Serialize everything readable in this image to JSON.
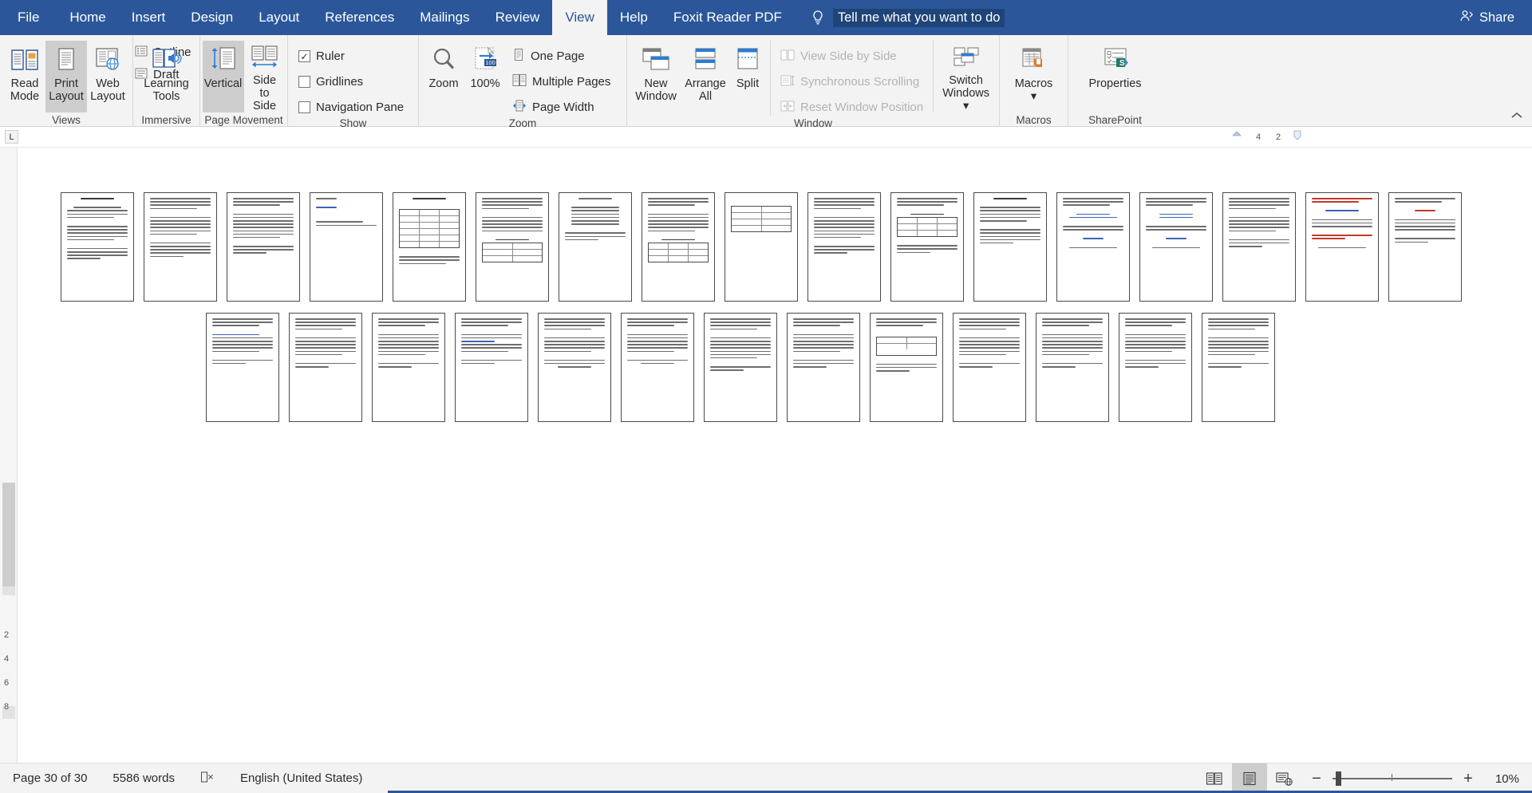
{
  "app": {
    "ribbon_tabs": [
      {
        "label": "File",
        "active": false
      },
      {
        "label": "Home",
        "active": false
      },
      {
        "label": "Insert",
        "active": false
      },
      {
        "label": "Design",
        "active": false
      },
      {
        "label": "Layout",
        "active": false
      },
      {
        "label": "References",
        "active": false
      },
      {
        "label": "Mailings",
        "active": false
      },
      {
        "label": "Review",
        "active": false
      },
      {
        "label": "View",
        "active": true
      },
      {
        "label": "Help",
        "active": false
      },
      {
        "label": "Foxit Reader PDF",
        "active": false
      }
    ],
    "tellme": {
      "icon": "lightbulb-icon",
      "text": "Tell me what you want to do"
    },
    "share": {
      "icon": "share-person-icon",
      "label": "Share"
    },
    "accent_color": "#2b579a",
    "tab_active_bg": "#f3f3f3"
  },
  "ribbon": {
    "groups": [
      {
        "name": "views",
        "label": "Views",
        "buttons": [
          {
            "name": "read-mode",
            "label_line1": "Read",
            "label_line2": "Mode",
            "icon": "read-mode-icon",
            "selected": false
          },
          {
            "name": "print-layout",
            "label_line1": "Print",
            "label_line2": "Layout",
            "icon": "print-layout-icon",
            "selected": true
          },
          {
            "name": "web-layout",
            "label_line1": "Web",
            "label_line2": "Layout",
            "icon": "web-layout-icon",
            "selected": false
          }
        ],
        "small_buttons": [
          {
            "name": "outline",
            "label": "Outline",
            "icon": "outline-icon"
          },
          {
            "name": "draft",
            "label": "Draft",
            "icon": "draft-icon"
          }
        ]
      },
      {
        "name": "immersive",
        "label": "Immersive",
        "buttons": [
          {
            "name": "learning-tools",
            "label_line1": "Learning",
            "label_line2": "Tools",
            "icon": "learning-tools-icon",
            "selected": false
          }
        ]
      },
      {
        "name": "page-movement",
        "label": "Page Movement",
        "buttons": [
          {
            "name": "vertical",
            "label_line1": "Vertical",
            "label_line2": "",
            "icon": "vertical-scroll-icon",
            "selected": true
          },
          {
            "name": "side-to-side",
            "label_line1": "Side",
            "label_line2": "to Side",
            "icon": "side-to-side-icon",
            "selected": false
          }
        ]
      },
      {
        "name": "show",
        "label": "Show",
        "checkboxes": [
          {
            "name": "ruler",
            "label": "Ruler",
            "checked": true
          },
          {
            "name": "gridlines",
            "label": "Gridlines",
            "checked": false
          },
          {
            "name": "navigation-pane",
            "label": "Navigation Pane",
            "checked": false
          }
        ]
      },
      {
        "name": "zoom",
        "label": "Zoom",
        "buttons": [
          {
            "name": "zoom",
            "label_line1": "Zoom",
            "label_line2": "",
            "icon": "magnifier-icon",
            "selected": false
          },
          {
            "name": "zoom-100",
            "label_line1": "100%",
            "label_line2": "",
            "icon": "zoom-100-icon",
            "selected": false
          }
        ],
        "small_buttons": [
          {
            "name": "one-page",
            "label": "One Page",
            "icon": "one-page-icon"
          },
          {
            "name": "multiple-pages",
            "label": "Multiple Pages",
            "icon": "multiple-pages-icon"
          },
          {
            "name": "page-width",
            "label": "Page Width",
            "icon": "page-width-icon"
          }
        ]
      },
      {
        "name": "window",
        "label": "Window",
        "buttons": [
          {
            "name": "new-window",
            "label_line1": "New",
            "label_line2": "Window",
            "icon": "new-window-icon",
            "selected": false
          },
          {
            "name": "arrange-all",
            "label_line1": "Arrange",
            "label_line2": "All",
            "icon": "arrange-all-icon",
            "selected": false
          },
          {
            "name": "split",
            "label_line1": "Split",
            "label_line2": "",
            "icon": "split-icon",
            "selected": false
          }
        ],
        "small_buttons": [
          {
            "name": "view-side-by-side",
            "label": "View Side by Side",
            "icon": "side-by-side-icon",
            "disabled": true
          },
          {
            "name": "synchronous-scrolling",
            "label": "Synchronous Scrolling",
            "icon": "sync-scroll-icon",
            "disabled": true
          },
          {
            "name": "reset-window-position",
            "label": "Reset Window Position",
            "icon": "reset-window-icon",
            "disabled": true
          }
        ],
        "buttons2": [
          {
            "name": "switch-windows",
            "label_line1": "Switch",
            "label_line2": "Windows",
            "icon": "switch-windows-icon",
            "dropdown": true
          }
        ]
      },
      {
        "name": "macros",
        "label": "Macros",
        "buttons": [
          {
            "name": "macros",
            "label_line1": "Macros",
            "label_line2": "",
            "icon": "macros-icon",
            "dropdown": true
          }
        ]
      },
      {
        "name": "sharepoint",
        "label": "SharePoint",
        "buttons": [
          {
            "name": "properties",
            "label_line1": "Properties",
            "label_line2": "",
            "icon": "sharepoint-properties-icon",
            "selected": false
          }
        ]
      }
    ],
    "collapse_icon": "chevron-up-icon"
  },
  "ruler": {
    "tab_stop_marker": "L",
    "marks": [
      "4",
      "2"
    ]
  },
  "document": {
    "page_count_displayed": 30,
    "thumbnails_row1": 17,
    "thumbnails_row2": 13
  },
  "statusbar": {
    "page_indicator": "Page 30 of 30",
    "word_count": "5586 words",
    "proofing_icon": "proofing-errors-icon",
    "language": "English (United States)",
    "view_buttons": [
      {
        "name": "read-mode-view",
        "icon": "read-mode-view-icon",
        "active": false
      },
      {
        "name": "print-layout-view",
        "icon": "print-layout-view-icon",
        "active": true
      },
      {
        "name": "web-layout-view",
        "icon": "web-layout-view-icon",
        "active": false
      }
    ],
    "zoom_out_icon": "minus-icon",
    "zoom_in_icon": "plus-icon",
    "zoom_level": "10%"
  }
}
